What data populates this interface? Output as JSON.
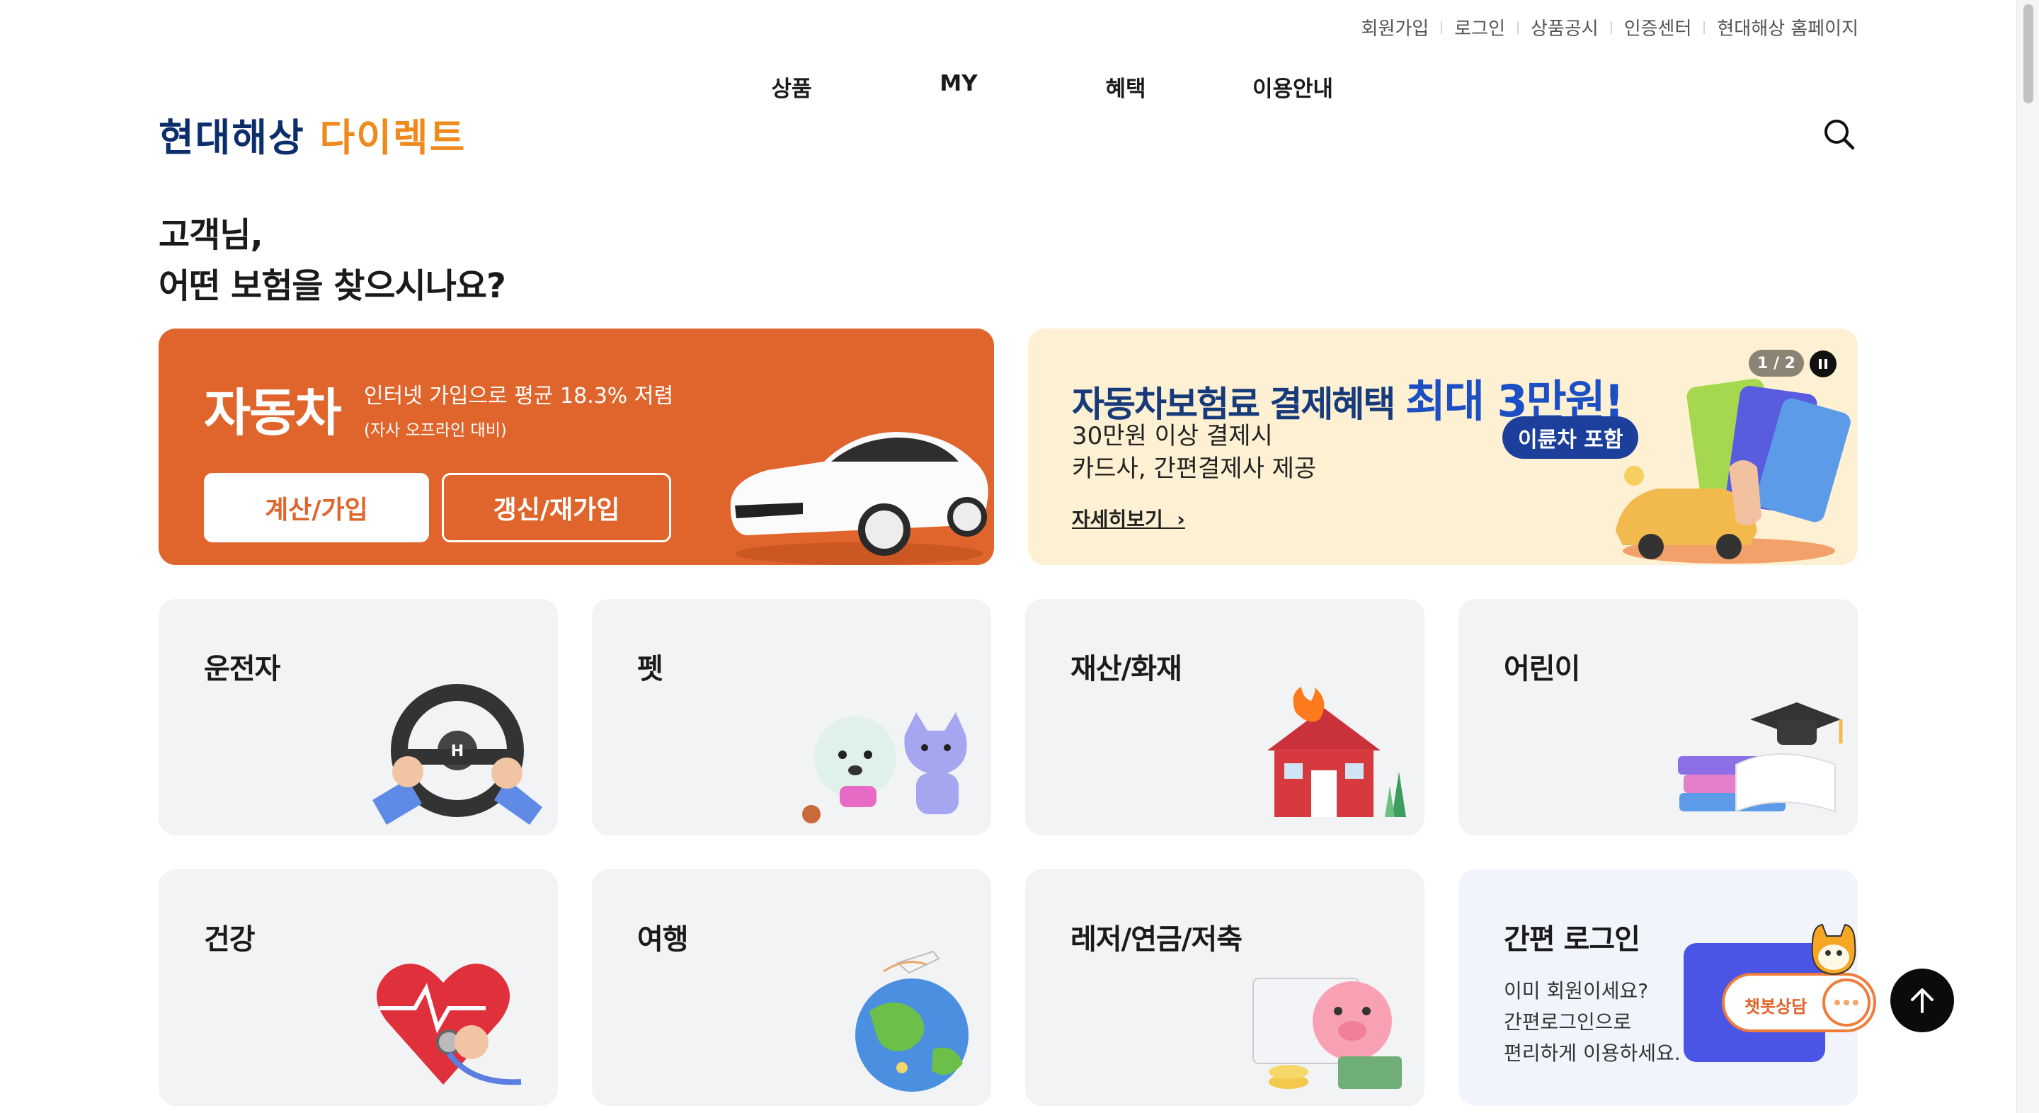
{
  "util_links": [
    "회원가입",
    "로그인",
    "상품공시",
    "인증센터",
    "현대해상 홈페이지"
  ],
  "nav": [
    "상품",
    "MY",
    "혜택",
    "이용안내"
  ],
  "logo": {
    "part1": "현대해상",
    "part2": "다이렉트",
    "color1": "#0d2e6c",
    "color2": "#ef8a1c"
  },
  "headline": {
    "line1": "고객님,",
    "line2": "어떤 보험을 찾으시나요?"
  },
  "car": {
    "title": "자동차",
    "desc": "인터넷 가입으로 평균 18.3% 저렴",
    "sub": "(자사 오프라인 대비)",
    "btn_calc": "계산/가입",
    "btn_renew": "갱신/재가입",
    "accent": "#e0652c"
  },
  "promo": {
    "title_prefix": "자동차보험료 결제혜택",
    "title_highlight": "최대 3만원!",
    "line1": "30만원 이상 결제시",
    "line2": "카드사, 간편결제사 제공",
    "pill": "이륜차 포함",
    "more": "자세히보기",
    "counter": "1 / 2"
  },
  "cards": [
    "운전자",
    "펫",
    "재산/화재",
    "어린이",
    "건강",
    "여행",
    "레저/연금/저축"
  ],
  "login_card": {
    "title": "간편 로그인",
    "line1": "이미 회원이세요?",
    "line2": "간편로그인으로",
    "line3": "편리하게 이용하세요."
  },
  "chatbot": {
    "label": "챗봇상담"
  }
}
